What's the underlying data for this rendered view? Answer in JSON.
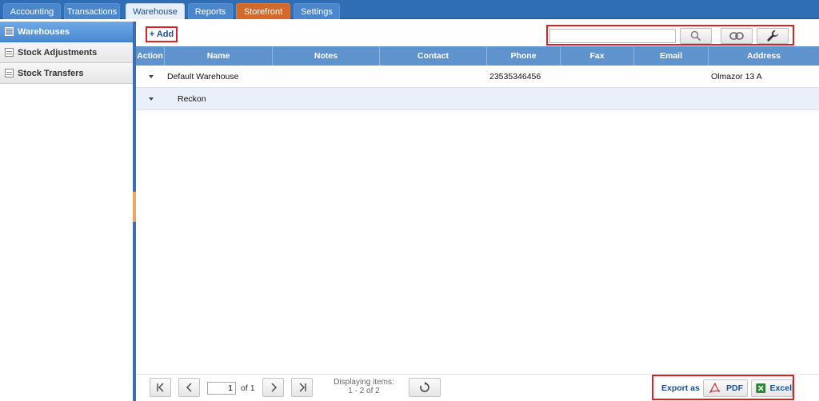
{
  "tabs": [
    {
      "label": "Accounting"
    },
    {
      "label": "Transactions"
    },
    {
      "label": "Warehouse"
    },
    {
      "label": "Reports"
    },
    {
      "label": "Storefront"
    },
    {
      "label": "Settings"
    }
  ],
  "active_tab": "Warehouse",
  "sidebar": {
    "items": [
      {
        "label": "Warehouses"
      },
      {
        "label": "Stock Adjustments"
      },
      {
        "label": "Stock Transfers"
      }
    ]
  },
  "toolbar": {
    "add_label": "+ Add",
    "search_value": "",
    "icons": [
      "search-icon",
      "link-icon",
      "wrench-icon"
    ]
  },
  "grid": {
    "columns": [
      "Action",
      "Name",
      "Notes",
      "Contact",
      "Phone",
      "Fax",
      "Email",
      "Address"
    ],
    "rows": [
      {
        "name": "Default Warehouse",
        "notes": "",
        "contact": "",
        "phone": "23535346456",
        "fax": "",
        "email": "",
        "address": "Olmazor 13 A"
      },
      {
        "name": "Reckon",
        "notes": "",
        "contact": "",
        "phone": "",
        "fax": "",
        "email": "",
        "address": ""
      }
    ]
  },
  "pager": {
    "current_page": "1",
    "of_label": "of",
    "total_pages": "1",
    "display_label": "Displaying items:",
    "display_range": "1 - 2 of 2"
  },
  "export": {
    "label": "Export as",
    "pdf_label": "PDF",
    "excel_label": "Excel"
  },
  "colors": {
    "topbar": "#2f6db5",
    "header": "#5f93ce",
    "storefront": "#d46a2a",
    "highlight": "#e02020"
  }
}
